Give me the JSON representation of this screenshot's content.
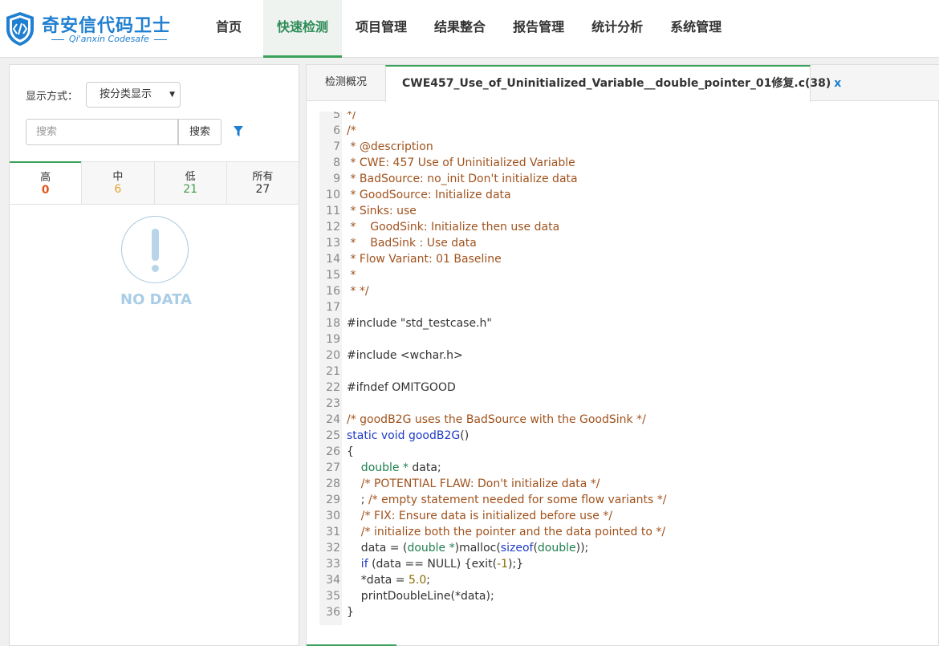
{
  "header": {
    "logo_title": "奇安信代码卫士",
    "logo_sub": "Qi'anxin Codesafe",
    "nav": [
      {
        "label": "首页",
        "active": false
      },
      {
        "label": "快速检测",
        "active": true
      },
      {
        "label": "项目管理",
        "active": false
      },
      {
        "label": "结果整合",
        "active": false
      },
      {
        "label": "报告管理",
        "active": false
      },
      {
        "label": "统计分析",
        "active": false
      },
      {
        "label": "系统管理",
        "active": false
      }
    ]
  },
  "left": {
    "display_label": "显示方式：",
    "display_value": "按分类显示",
    "search_placeholder": "搜索",
    "search_button": "搜索",
    "severity_tabs": [
      {
        "label": "高",
        "count": "0",
        "color": "#e0581c"
      },
      {
        "label": "中",
        "count": "6",
        "color": "#e3a32a"
      },
      {
        "label": "低",
        "count": "21",
        "color": "#3f9a4c"
      },
      {
        "label": "所有",
        "count": "27",
        "color": "#333333"
      }
    ],
    "empty_text": "NO DATA"
  },
  "right": {
    "tabs": [
      {
        "label": "检测概况"
      },
      {
        "label": "CWE457_Use_of_Uninitialized_Variable__double_pointer_01修复.c(38)",
        "close": "x"
      }
    ],
    "code_lines": [
      {
        "n": "5",
        "parts": [
          {
            "t": "*/",
            "c": "comment"
          }
        ]
      },
      {
        "n": "6",
        "parts": [
          {
            "t": "/*",
            "c": "comment"
          }
        ]
      },
      {
        "n": "7",
        "parts": [
          {
            "t": " * @description",
            "c": "comment"
          }
        ]
      },
      {
        "n": "8",
        "parts": [
          {
            "t": " * CWE: 457 Use of Uninitialized Variable",
            "c": "comment"
          }
        ]
      },
      {
        "n": "9",
        "parts": [
          {
            "t": " * BadSource: no_init Don't initialize data",
            "c": "comment"
          }
        ]
      },
      {
        "n": "10",
        "parts": [
          {
            "t": " * GoodSource: Initialize data",
            "c": "comment"
          }
        ]
      },
      {
        "n": "11",
        "parts": [
          {
            "t": " * Sinks: use",
            "c": "comment"
          }
        ]
      },
      {
        "n": "12",
        "parts": [
          {
            "t": " *    GoodSink: Initialize then use data",
            "c": "comment"
          }
        ]
      },
      {
        "n": "13",
        "parts": [
          {
            "t": " *    BadSink : Use data",
            "c": "comment"
          }
        ]
      },
      {
        "n": "14",
        "parts": [
          {
            "t": " * Flow Variant: 01 Baseline",
            "c": "comment"
          }
        ]
      },
      {
        "n": "15",
        "parts": [
          {
            "t": " *",
            "c": "comment"
          }
        ]
      },
      {
        "n": "16",
        "parts": [
          {
            "t": " * */",
            "c": "comment"
          }
        ]
      },
      {
        "n": "17",
        "parts": []
      },
      {
        "n": "18",
        "parts": [
          {
            "t": "#include \"std_testcase.h\"",
            "c": "plain"
          }
        ]
      },
      {
        "n": "19",
        "parts": []
      },
      {
        "n": "20",
        "parts": [
          {
            "t": "#include <wchar.h>",
            "c": "plain"
          }
        ]
      },
      {
        "n": "21",
        "parts": []
      },
      {
        "n": "22",
        "parts": [
          {
            "t": "#ifndef OMITGOOD",
            "c": "plain"
          }
        ]
      },
      {
        "n": "23",
        "parts": []
      },
      {
        "n": "24",
        "parts": [
          {
            "t": "/* goodB2G uses the BadSource with the GoodSink */",
            "c": "comment"
          }
        ]
      },
      {
        "n": "25",
        "parts": [
          {
            "t": "static ",
            "c": "kw"
          },
          {
            "t": "void ",
            "c": "kw"
          },
          {
            "t": "goodB2G",
            "c": "kw"
          },
          {
            "t": "()",
            "c": "plain"
          }
        ]
      },
      {
        "n": "26",
        "parts": [
          {
            "t": "{",
            "c": "plain"
          }
        ]
      },
      {
        "n": "27",
        "parts": [
          {
            "t": "    double * ",
            "c": "type"
          },
          {
            "t": "data;",
            "c": "plain"
          }
        ]
      },
      {
        "n": "28",
        "parts": [
          {
            "t": "    /* POTENTIAL FLAW: Don't initialize data */",
            "c": "comment"
          }
        ]
      },
      {
        "n": "29",
        "parts": [
          {
            "t": "    ; ",
            "c": "plain"
          },
          {
            "t": "/* empty statement needed for some flow variants */",
            "c": "comment"
          }
        ]
      },
      {
        "n": "30",
        "parts": [
          {
            "t": "    /* FIX: Ensure data is initialized before use */",
            "c": "comment"
          }
        ]
      },
      {
        "n": "31",
        "parts": [
          {
            "t": "    /* initialize both the pointer and the data pointed to */",
            "c": "comment"
          }
        ]
      },
      {
        "n": "32",
        "parts": [
          {
            "t": "    data = (",
            "c": "plain"
          },
          {
            "t": "double *",
            "c": "type"
          },
          {
            "t": ")malloc(",
            "c": "plain"
          },
          {
            "t": "sizeof",
            "c": "kw"
          },
          {
            "t": "(",
            "c": "plain"
          },
          {
            "t": "double",
            "c": "type"
          },
          {
            "t": "));",
            "c": "plain"
          }
        ]
      },
      {
        "n": "33",
        "parts": [
          {
            "t": "    if ",
            "c": "kw"
          },
          {
            "t": "(data == NULL) {exit(",
            "c": "plain"
          },
          {
            "t": "-1",
            "c": "num"
          },
          {
            "t": ");}",
            "c": "plain"
          }
        ]
      },
      {
        "n": "34",
        "parts": [
          {
            "t": "    *data = ",
            "c": "plain"
          },
          {
            "t": "5.0",
            "c": "num"
          },
          {
            "t": ";",
            "c": "plain"
          }
        ]
      },
      {
        "n": "35",
        "parts": [
          {
            "t": "    printDoubleLine(*data);",
            "c": "plain"
          }
        ]
      },
      {
        "n": "36",
        "parts": [
          {
            "t": "}",
            "c": "plain"
          }
        ]
      }
    ]
  },
  "icons": {
    "logo": "code-shield-icon",
    "filter": "filter-funnel-icon",
    "empty": "exclamation-circle-icon",
    "caret": "caret-down-icon"
  },
  "colors": {
    "brand": "#1f7fd0",
    "accent": "#3aa05a",
    "comment": "#a0521d",
    "keyword": "#1f3ac6",
    "type": "#1f7f4f"
  }
}
